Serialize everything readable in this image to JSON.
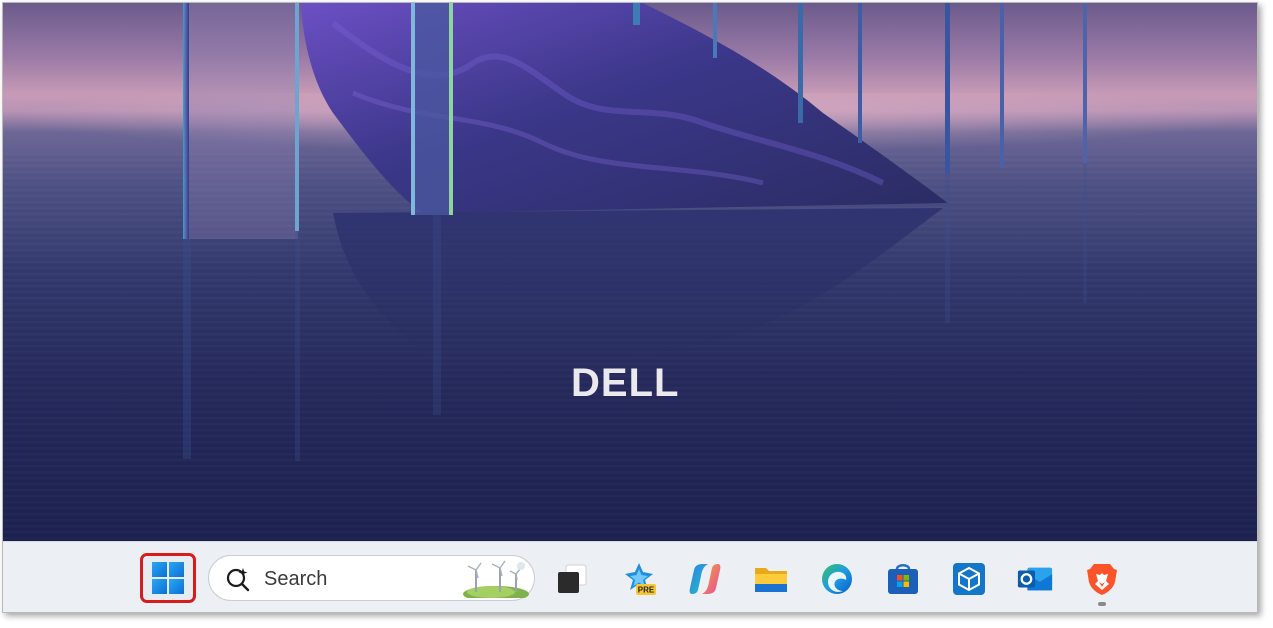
{
  "desktop": {
    "wallpaper_logo": "DELL"
  },
  "taskbar": {
    "start_button": {
      "icon": "windows-logo-icon",
      "highlight_color": "#d61c1c"
    },
    "search": {
      "placeholder": "Search",
      "icon": "search-sparkle-icon"
    },
    "apps": [
      {
        "name": "task-view",
        "icon": "task-view-icon"
      },
      {
        "name": "copilot-preview",
        "icon": "copilot-pre-icon",
        "badge": "PRE"
      },
      {
        "name": "copilot",
        "icon": "copilot-icon"
      },
      {
        "name": "file-explorer",
        "icon": "folder-icon"
      },
      {
        "name": "edge",
        "icon": "edge-icon"
      },
      {
        "name": "microsoft-store",
        "icon": "store-icon"
      },
      {
        "name": "dev-home",
        "icon": "cube-icon"
      },
      {
        "name": "outlook",
        "icon": "outlook-icon"
      },
      {
        "name": "brave",
        "icon": "brave-lion-icon",
        "running": true
      }
    ]
  },
  "colors": {
    "taskbar_bg": "#eceff4",
    "start_highlight": "#d61c1c",
    "windows_blue": "#1f8fe8"
  }
}
